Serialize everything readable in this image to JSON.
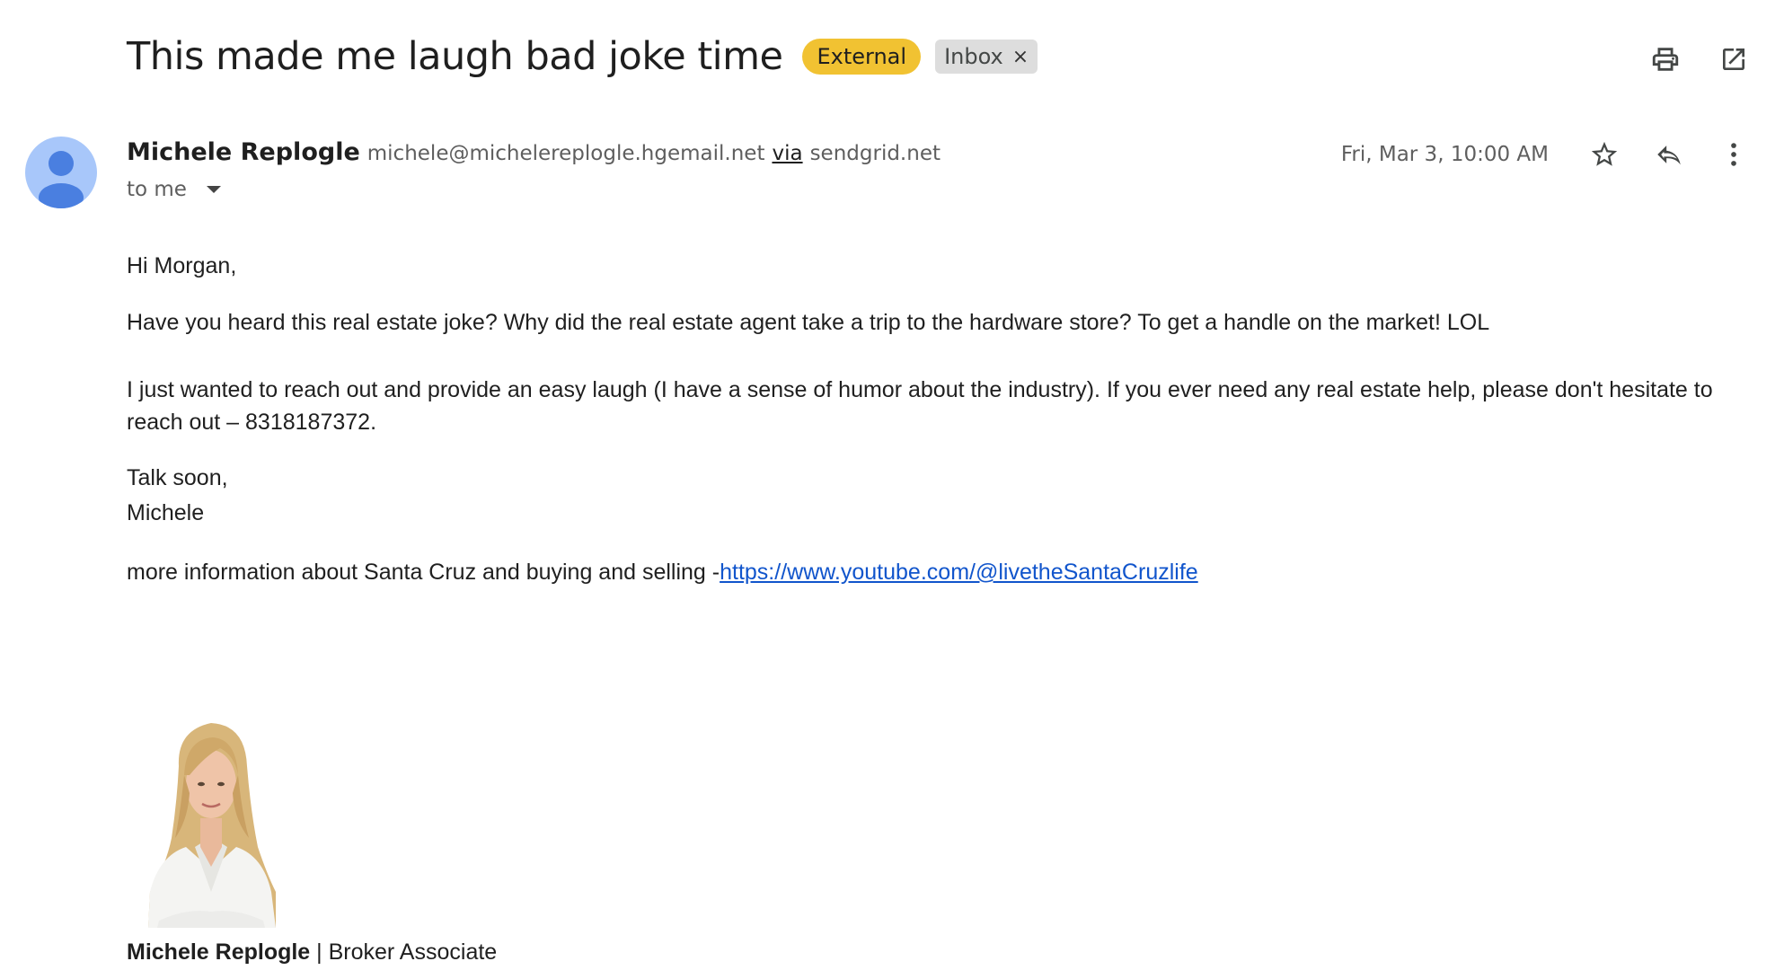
{
  "header": {
    "subject": "This made me laugh bad joke time",
    "badge": "External",
    "label": "Inbox",
    "label_remove": "×"
  },
  "sender": {
    "name": "Michele Replogle",
    "email": "michele@michelereplogle.hgemail.net",
    "via": "via",
    "via_domain": "sendgrid.net",
    "to": "to me",
    "date": "Fri, Mar 3, 10:00 AM"
  },
  "body": {
    "greeting": "Hi Morgan,",
    "joke": "Have you heard this real estate joke? Why did the real estate agent take a trip to the hardware store? To get a handle on the market! LOL",
    "reach_out": "I just wanted to reach out and provide an easy laugh (I have a sense of humor about the industry). If you ever need any real estate help, please don't hesitate to reach out – 8318187372.",
    "closing": "Talk soon,",
    "signoff": "Michele",
    "more_info": "more information about Santa Cruz and buying and selling -",
    "link": "https://www.youtube.com/@livetheSantaCruzlife"
  },
  "signature": {
    "name": "Michele Replogle",
    "separator": " | ",
    "title": "Broker Associate"
  },
  "icons": {
    "print": "print-icon",
    "open_new": "open-in-new-window-icon",
    "star": "star-icon",
    "reply": "reply-icon",
    "more": "more-vertical-icon"
  },
  "colors": {
    "external_badge": "#f1c232",
    "avatar": "#a8c7fa",
    "avatar_figure": "#4a7fe0",
    "link": "#1155cc"
  }
}
